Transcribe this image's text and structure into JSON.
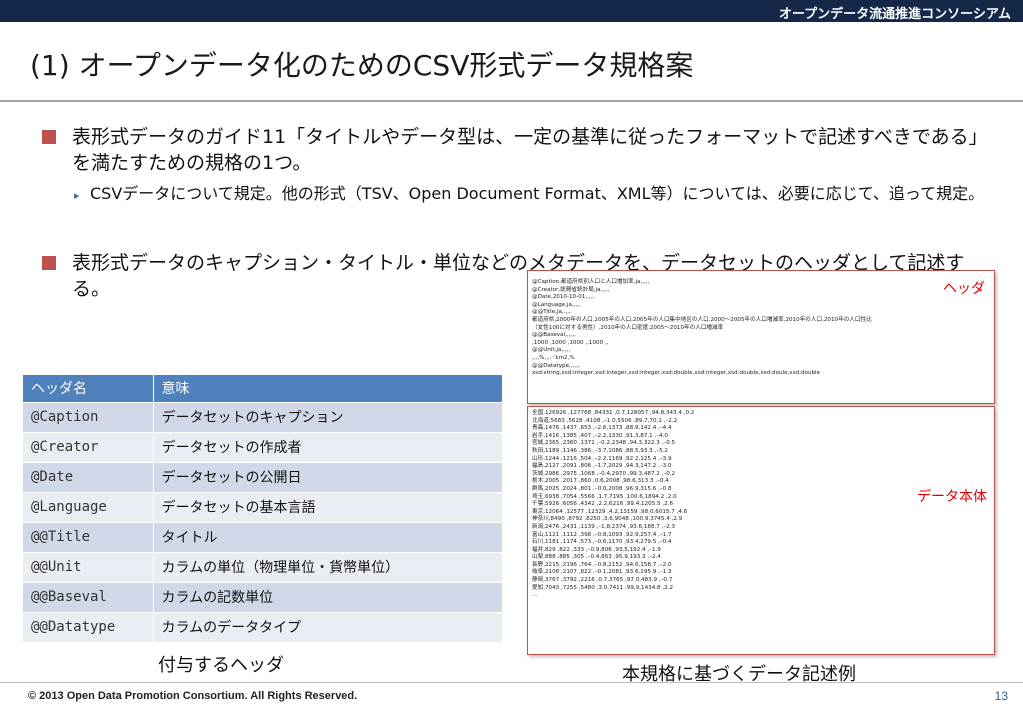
{
  "header": {
    "org": "オープンデータ流通推進コンソーシアム",
    "bar_color": "#15284a"
  },
  "title": "(1) オープンデータ化のためのCSV形式データ規格案",
  "bullets": {
    "b1": "表形式データのガイド11「タイトルやデータ型は、一定の基準に従ったフォーマットで記述すべきである」を満たすための規格の1つ。",
    "b2": "CSVデータについて規定。他の形式（TSV、Open Document Format、XML等）については、必要に応じて、追って規定。",
    "b3": "表形式データのキャプション・タイトル・単位などのメタデータを、データセットのヘッダとして記述する。"
  },
  "header_table": {
    "col_headers": [
      "ヘッダ名",
      "意味"
    ],
    "rows": [
      {
        "key": "@Caption",
        "meaning": "データセットのキャプション"
      },
      {
        "key": "@Creator",
        "meaning": "データセットの作成者"
      },
      {
        "key": "@Date",
        "meaning": "データセットの公開日"
      },
      {
        "key": "@Language",
        "meaning": "データセットの基本言語"
      },
      {
        "key": "@@Title",
        "meaning": "タイトル"
      },
      {
        "key": "@@Unit",
        "meaning": "カラムの単位（物理単位・貨幣単位）"
      },
      {
        "key": "@@Baseval",
        "meaning": "カラムの記数単位"
      },
      {
        "key": "@@Datatype",
        "meaning": "カラムのデータタイプ"
      }
    ],
    "caption": "付与するヘッダ"
  },
  "example": {
    "head_label": "ヘッダ",
    "body_label": "データ本体",
    "caption": "本規格に基づくデータ記述例",
    "head_lines": [
      "@Caption,都道府県別人口と人口増加率,ja,,,,,",
      "@Creator,総務省統計局,ja,,,,,",
      "@Date,2010-10-01,,,,,",
      "@Language,ja,,,,,",
      "@@Title,ja,,,,,",
      "都道府県,2000年の人口,2005年の人口,2005年の人口集中地区の人口,2000～2005年の人口増減率,2010年の人口,2010年の人口性比",
      "（女性100に対する男性）,2010年の人口密度,2005～2010年の人口増減率",
      "@@Baseval,,,,,,",
      ",1000 ,1000 ,1000 ,,1000 ,,",
      "@@Unit,ja,,,,,",
      ",,,,%,,,／km2,%",
      "@@Datatype,,,,,,",
      "xsd:string,xsd:integer,xsd:integer,xsd:integer,xsd:double,xsd:integer,xsd:double,xsd:doule,xsd:double"
    ],
    "body_lines": [
      "全国,126926 ,127768 ,84331 ,0.7,128057 ,94.8,343.4 ,0.2",
      "北海道,5683 ,5628 ,4108 ,–1.0,5506 ,89.7,70.2 ,–2.2",
      "青森,1476 ,1437 ,653 ,–2.6,1373 ,88.9,142.4 ,–4.4",
      "岩手,1416 ,1385 ,407 ,–2.2,1330 ,91.3,87.1 ,–4.0",
      "宮城,2365 ,2360 ,1371 ,–0.2,2348 ,94.3,322.3 ,–0.5",
      "秋田,1189 ,1146 ,386 ,–3.7,1086 ,88.5,93.3 ,–5.2",
      "山形,1244 ,1216 ,504 ,–2.2,1169 ,92.2,125.4 ,–3.9",
      "福島,2127 ,2091 ,806 ,–1.7,2029 ,94.3,147.2 ,–3.0",
      "茨城,2986 ,2975 ,1068 ,–0.4,2970 ,99.3,487.2 ,–0.2",
      "栃木,2005 ,2017 ,860 ,0.6,2008 ,98.6,313.3 ,–0.4",
      "群馬,2025 ,2024 ,801 ,–0.0,2008 ,96.9,315.6 ,–0.8",
      "埼玉,6938 ,7054 ,5566 ,1.7,7195 ,100.6,1894.2 ,2.0",
      "千葉,5926 ,6056 ,4342 ,2.2,6216 ,99.4,1205.5 ,2.6",
      "東京,12064 ,12577 ,12329 ,4.2,13159 ,98.0,6015.7 ,4.6",
      "神奈川,8490 ,8792 ,8250 ,3.6,9048 ,100.9,3745.4 ,2.9",
      "新潟,2476 ,2431 ,1139 ,–1.8,2374 ,93.6,188.7 ,–2.3",
      "富山,1121 ,1112 ,398 ,–0.8,1093 ,92.9,257.4 ,–1.7",
      "石川,1181 ,1174 ,573 ,–0.6,1170 ,93.4,279.5 ,–0.4",
      "福井,829 ,822 ,333 ,–0.9,806 ,93.5,192.4 ,–1.9",
      "山梨,888 ,885 ,305 ,–0.4,863 ,95.9,193.3 ,–2.4",
      "長野,2215 ,2196 ,764 ,–0.8,2152 ,94.6,158.7 ,–2.0",
      "岐阜,2108 ,2107 ,822 ,–0.1,2081 ,93.6,195.9 ,–1.3",
      "静岡,3767 ,3792 ,2216 ,0.7,3765 ,97.0,483.9 ,–0.7",
      "愛知,7043 ,7255 ,5480 ,3.0,7411 ,99.9,1434.8 ,2.2",
      "..."
    ],
    "accent_color": "#c0504d"
  },
  "footer": {
    "copyright": "© 2013 Open Data Promotion Consortium. All Rights Reserved.",
    "page": "13"
  }
}
